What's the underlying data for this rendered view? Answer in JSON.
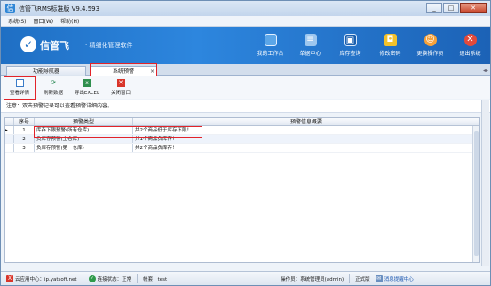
{
  "window": {
    "title": "信管飞RMS标准版 V9.4.593",
    "buttons": [
      "_",
      "□",
      "✕"
    ]
  },
  "menu": [
    "系统(S)",
    "窗口(W)",
    "帮助(H)"
  ],
  "banner": {
    "brand": "信管飞",
    "slogan": "· 精细化管理软件",
    "buttons": [
      {
        "label": "我的工作台",
        "icon": "monitor-icon"
      },
      {
        "label": "单据中心",
        "icon": "document-icon"
      },
      {
        "label": "库存查询",
        "icon": "warehouse-icon"
      },
      {
        "label": "修改密码",
        "icon": "lock-icon"
      },
      {
        "label": "更换操作员",
        "icon": "user-icon"
      },
      {
        "label": "退出系统",
        "icon": "exit-icon"
      }
    ]
  },
  "tabs": {
    "nav": "功能导航器",
    "alarm": "系统预警",
    "close": "×",
    "scroll": "◂▸"
  },
  "toolbar": {
    "view_details": "查看详情",
    "refresh": "刷新数据",
    "export": "导出EXCEL",
    "close_window": "关闭窗口"
  },
  "notice": "注意：双击预警记录可以查看预警详细内容。",
  "table": {
    "headers": {
      "no": "序号",
      "type": "预警类型",
      "info": "预警信息概要"
    },
    "rows": [
      {
        "no": "1",
        "type": "库存下限预警(所有仓库)",
        "info": "共2个商品低于库存下限！",
        "pointer": "▸"
      },
      {
        "no": "2",
        "type": "负库存预警(主仓库)",
        "info": "共1个商品负库存！",
        "pointer": ""
      },
      {
        "no": "3",
        "type": "负库存预警(第一仓库)",
        "info": "共2个商品负库存！",
        "pointer": ""
      }
    ]
  },
  "status": {
    "cloud": "云应用中心：ip.yatsoft.net",
    "cloud_mark": "X",
    "connection": "连接状态：正常",
    "account": "帐套：test",
    "operator": "操作员：系统管理员(admin)",
    "edition": "正式版",
    "message_link": "消息提醒中心"
  },
  "colors": {
    "banner": "#1f6fc4",
    "highlight": "#e2232a"
  }
}
